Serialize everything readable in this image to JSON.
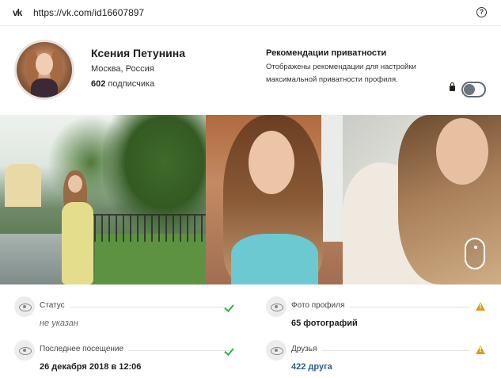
{
  "browser": {
    "url": "https://vk.com/id16607897",
    "logo_icon": "vk-logo-icon",
    "help_icon": "question-circle-icon",
    "logo_text": "vk",
    "help_text": "?"
  },
  "profile": {
    "name": "Ксения Петунина",
    "location": "Москва, Россия",
    "subscribers_count": "602",
    "subscribers_label": " подписчика"
  },
  "privacy": {
    "title": "Рекомендации приватности",
    "description": "Отображены рекомендации для настройки максимальной приватности профиля.",
    "toggle_on": false,
    "lock_icon": "lock-icon"
  },
  "photos": [
    {
      "name": "photo-1"
    },
    {
      "name": "photo-2"
    },
    {
      "name": "photo-3"
    }
  ],
  "stats": [
    {
      "label": "Статус",
      "value": "не указан",
      "style": "muted",
      "status_icon": "check-icon",
      "status_color": "#2db24a"
    },
    {
      "label": "Фото профиля",
      "value": "65 фотографий",
      "style": "bold",
      "status_icon": "warning-icon",
      "status_color": "#d99b1a"
    },
    {
      "label": "Последнее посещение",
      "value": "26 декабря 2018 в 12:06",
      "style": "bold",
      "status_icon": "check-icon",
      "status_color": "#2db24a"
    },
    {
      "label": "Друзья",
      "value": "422 друга",
      "style": "link",
      "status_icon": "warning-icon",
      "status_color": "#d99b1a"
    }
  ]
}
